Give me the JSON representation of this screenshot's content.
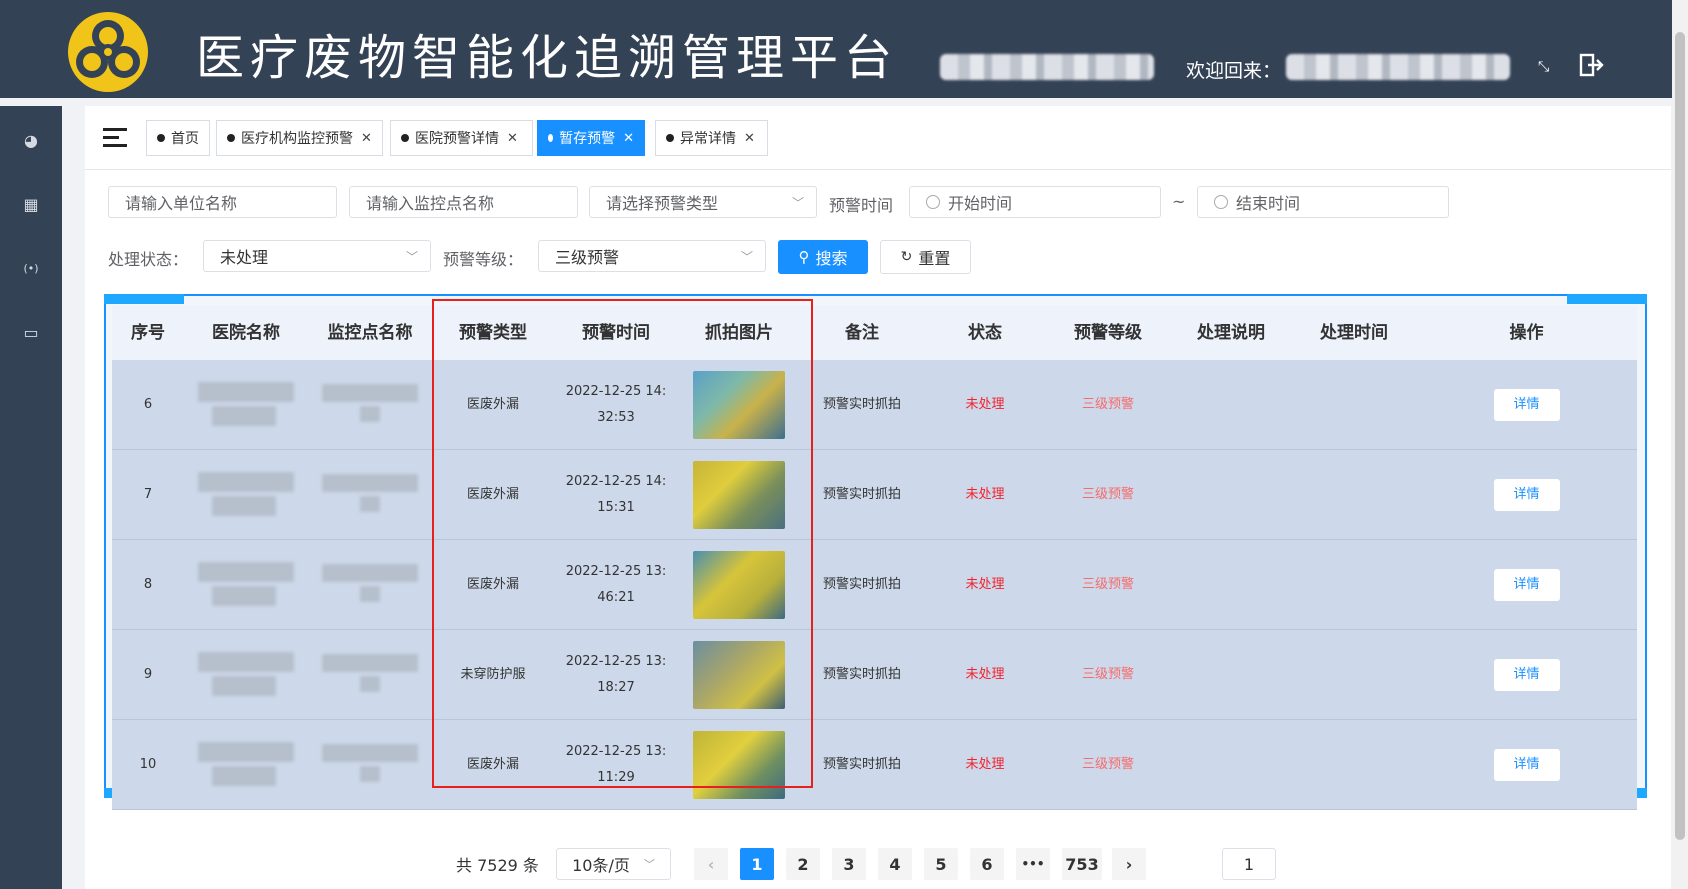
{
  "header": {
    "title": "医疗废物智能化追溯管理平台",
    "welcome": "欢迎回来："
  },
  "tabs": [
    {
      "label": "首页",
      "closable": false,
      "active": false
    },
    {
      "label": "医疗机构监控预警",
      "closable": true,
      "active": false
    },
    {
      "label": "医院预警详情",
      "closable": true,
      "active": false
    },
    {
      "label": "暂存预警",
      "closable": true,
      "active": true
    },
    {
      "label": "异常详情",
      "closable": true,
      "active": false
    }
  ],
  "filters": {
    "unit_placeholder": "请输入单位名称",
    "monitor_placeholder": "请输入监控点名称",
    "type_placeholder": "请选择预警类型",
    "time_label": "预警时间",
    "start_placeholder": "开始时间",
    "tilde": "~",
    "end_placeholder": "结束时间",
    "status_label": "处理状态：",
    "status_value": "未处理",
    "level_label": "预警等级：",
    "level_value": "三级预警",
    "search_label": "搜索",
    "reset_label": "重置"
  },
  "table": {
    "columns": [
      "序号",
      "医院名称",
      "监控点名称",
      "预警类型",
      "预警时间",
      "抓拍图片",
      "备注",
      "状态",
      "预警等级",
      "处理说明",
      "处理时间",
      "操作"
    ],
    "rows": [
      {
        "index": "6",
        "type": "医废外漏",
        "time_l1": "2022-12-25 14:",
        "time_l2": "32:53",
        "note": "预警实时抓拍",
        "status": "未处理",
        "level": "三级预警",
        "action": "详情"
      },
      {
        "index": "7",
        "type": "医废外漏",
        "time_l1": "2022-12-25 14:",
        "time_l2": "15:31",
        "note": "预警实时抓拍",
        "status": "未处理",
        "level": "三级预警",
        "action": "详情"
      },
      {
        "index": "8",
        "type": "医废外漏",
        "time_l1": "2022-12-25 13:",
        "time_l2": "46:21",
        "note": "预警实时抓拍",
        "status": "未处理",
        "level": "三级预警",
        "action": "详情"
      },
      {
        "index": "9",
        "type": "未穿防护服",
        "time_l1": "2022-12-25 13:",
        "time_l2": "18:27",
        "note": "预警实时抓拍",
        "status": "未处理",
        "level": "三级预警",
        "action": "详情"
      },
      {
        "index": "10",
        "type": "医废外漏",
        "time_l1": "2022-12-25 13:",
        "time_l2": "11:29",
        "note": "预警实时抓拍",
        "status": "未处理",
        "level": "三级预警",
        "action": "详情"
      }
    ]
  },
  "pagination": {
    "total": "共 7529 条",
    "page_size": "10条/页",
    "prev": "‹",
    "pages": [
      "1",
      "2",
      "3",
      "4",
      "5",
      "6"
    ],
    "ellipsis": "•••",
    "last": "753",
    "next": "›",
    "jump_value": "1"
  },
  "colors": {
    "header_bg": "#344256",
    "accent": "#1890ff",
    "danger": "#f5222d",
    "row_bg": "#cdd9ea",
    "highlight": "#e8201c"
  }
}
